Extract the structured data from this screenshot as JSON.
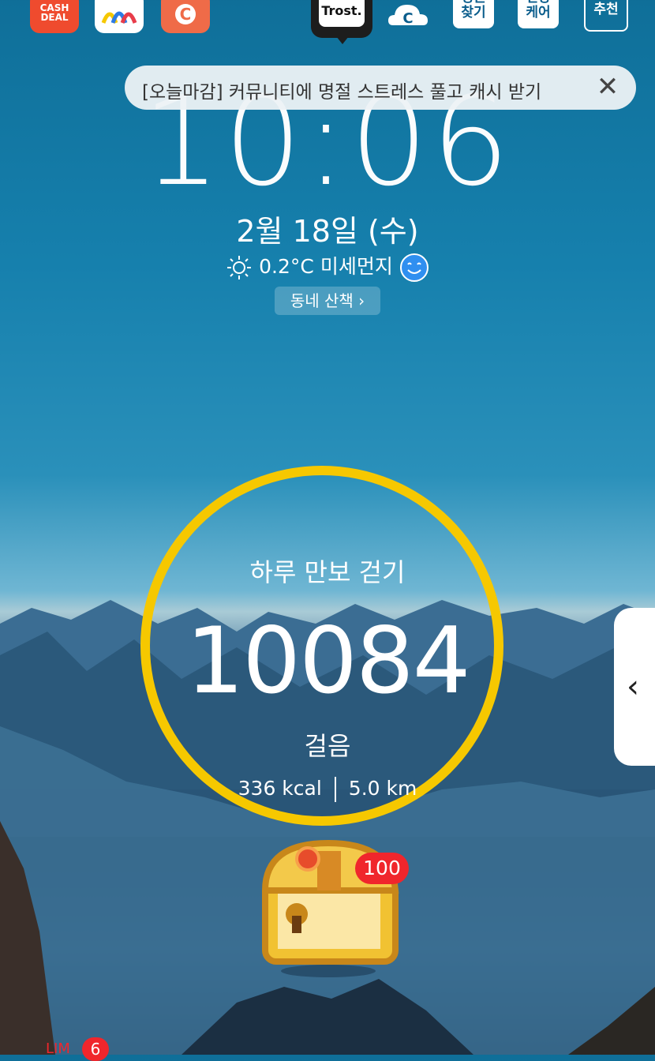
{
  "top_apps": {
    "cash_deal": {
      "label_line1": "CASH",
      "label_line2": "DEAL"
    },
    "trost": {
      "label": "Trost."
    },
    "tiles": [
      {
        "line1": "명원",
        "line2": "찾기"
      },
      {
        "line1": "건강",
        "line2": "케어"
      },
      {
        "line1": "추천",
        "line2": ""
      }
    ]
  },
  "banner": {
    "text": "[오늘마감] 커뮤니티에 명절 스트레스 풀고 캐시 받기",
    "close_icon": "close-icon"
  },
  "lockscreen": {
    "time": "10:06",
    "date": "2월 18일 (수)",
    "temperature": "0.2°C",
    "dust_label": "미세먼지",
    "walk_button": "동네 산책"
  },
  "pedometer": {
    "title": "하루 만보 걷기",
    "steps": "10084",
    "unit": "걸음",
    "kcal": "336 kcal",
    "distance": "5.0 km",
    "ring_color": "#f6c800"
  },
  "reward": {
    "badge": "100"
  },
  "notification": {
    "label": "LIM",
    "count": "6"
  },
  "colors": {
    "sky": "#1680ad",
    "badge_red": "#f0262c",
    "banner_bg": "#edf2f5"
  }
}
